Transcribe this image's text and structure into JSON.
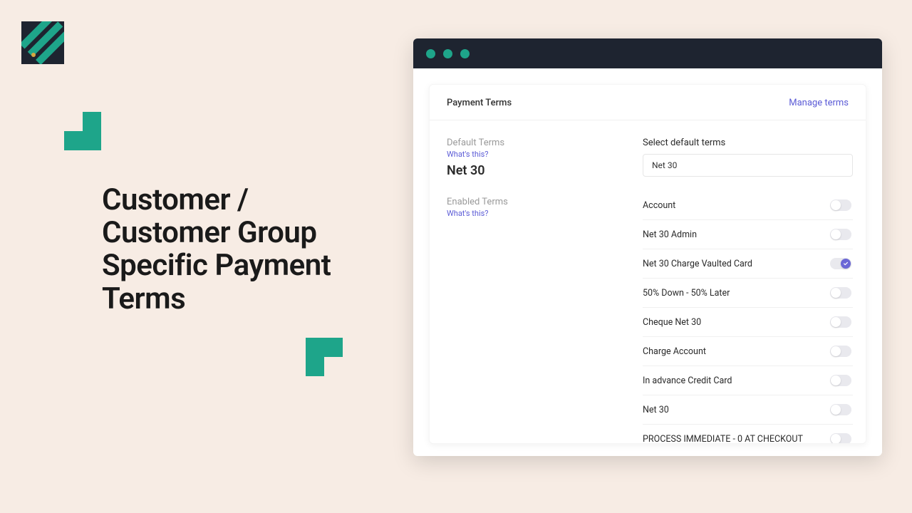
{
  "headline": "Customer / Customer Group Specific Payment Terms",
  "panel": {
    "title": "Payment Terms",
    "manage_link": "Manage terms",
    "default_terms_label": "Default Terms",
    "whats_this": "What's this?",
    "default_terms_value": "Net 30",
    "enabled_terms_label": "Enabled Terms",
    "select_label": "Select default terms",
    "select_value": "Net 30",
    "terms": [
      {
        "name": "Account",
        "enabled": false
      },
      {
        "name": "Net 30 Admin",
        "enabled": false
      },
      {
        "name": "Net 30 Charge Vaulted Card",
        "enabled": true
      },
      {
        "name": "50% Down - 50% Later",
        "enabled": false
      },
      {
        "name": "Cheque Net 30",
        "enabled": false
      },
      {
        "name": "Charge Account",
        "enabled": false
      },
      {
        "name": "In advance Credit Card",
        "enabled": false
      },
      {
        "name": "Net 30",
        "enabled": false
      },
      {
        "name": "PROCESS IMMEDIATE - 0 AT CHECKOUT",
        "enabled": false
      }
    ]
  }
}
